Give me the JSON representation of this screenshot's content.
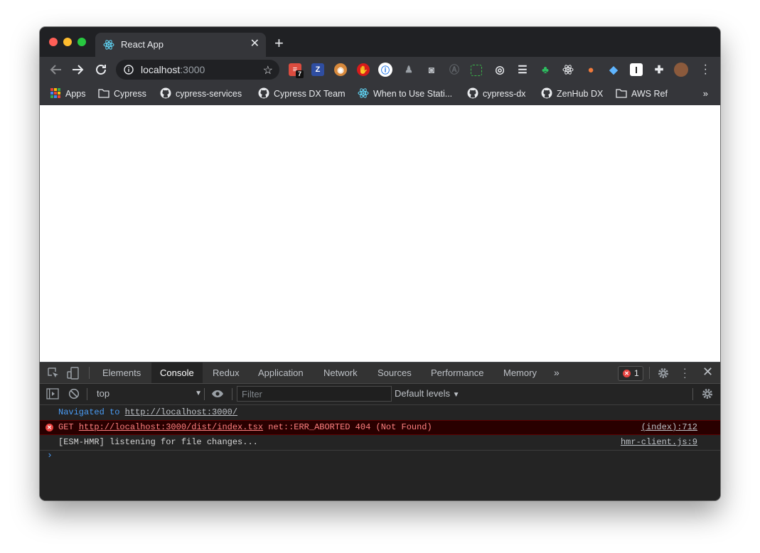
{
  "tab": {
    "title": "React App"
  },
  "omnibox": {
    "host": "localhost",
    "port": ":3000"
  },
  "extensions": {
    "todoist_badge": "7"
  },
  "bookmarks": [
    "Apps",
    "Cypress",
    "cypress-services",
    "Cypress DX Team",
    "When to Use Stati...",
    "cypress-dx",
    "ZenHub DX",
    "AWS Ref"
  ],
  "devtools": {
    "tabs": [
      "Elements",
      "Console",
      "Redux",
      "Application",
      "Network",
      "Sources",
      "Performance",
      "Memory"
    ],
    "active_tab": "Console",
    "error_count": "1",
    "context": "top",
    "filter_placeholder": "Filter",
    "levels": "Default levels"
  },
  "console": {
    "navigated_prefix": "Navigated to",
    "navigated_url": "http://localhost:3000/",
    "error_method": "GET",
    "error_url": "http://localhost:3000/dist/index.tsx",
    "error_text": "net::ERR_ABORTED 404 (Not Found)",
    "error_source": "(index):712",
    "info_text": "[ESM-HMR] listening for file changes...",
    "info_source": "hmr-client.js:9"
  },
  "colors": {
    "chrome_dark": "#202124",
    "toolbar": "#35363a",
    "devtools_bg": "#242424",
    "error_red": "#e8423f",
    "link_blue": "#4a9cf5"
  }
}
